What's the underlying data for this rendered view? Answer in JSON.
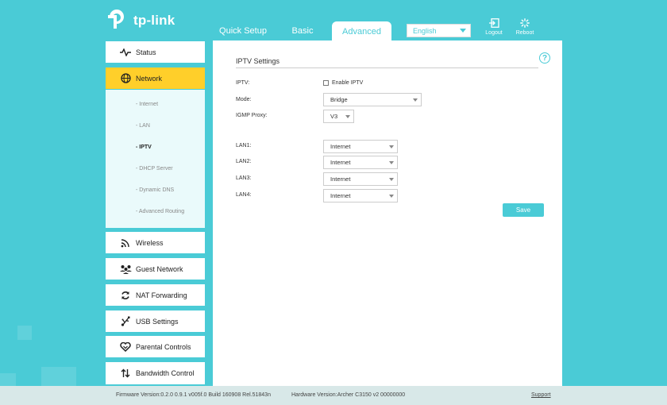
{
  "brand": {
    "name": "tp-link"
  },
  "tabs": [
    {
      "label": "Quick Setup"
    },
    {
      "label": "Basic"
    },
    {
      "label": "Advanced"
    }
  ],
  "language": {
    "selected": "English"
  },
  "header_buttons": {
    "logout": "Logout",
    "reboot": "Reboot"
  },
  "sidebar": {
    "items": [
      {
        "label": "Status",
        "icon": "pulse-icon"
      },
      {
        "label": "Network",
        "icon": "globe-icon"
      },
      {
        "label": "Wireless",
        "icon": "wifi-icon"
      },
      {
        "label": "Guest Network",
        "icon": "users-icon"
      },
      {
        "label": "NAT Forwarding",
        "icon": "refresh-icon"
      },
      {
        "label": "USB Settings",
        "icon": "usb-icon"
      },
      {
        "label": "Parental Controls",
        "icon": "heart-icon"
      },
      {
        "label": "Bandwidth Control",
        "icon": "updown-arrows-icon"
      }
    ],
    "network_sub": [
      "- Internet",
      "- LAN",
      "- IPTV",
      "- DHCP Server",
      "- Dynamic DNS",
      "- Advanced Routing"
    ]
  },
  "main": {
    "title": "IPTV Settings",
    "iptv_label": "IPTV:",
    "enable_iptv": "Enable IPTV",
    "mode_label": "Mode:",
    "mode_value": "Bridge",
    "igmp_label": "IGMP Proxy:",
    "igmp_value": "V3",
    "lans": [
      {
        "label": "LAN1:",
        "value": "Internet"
      },
      {
        "label": "LAN2:",
        "value": "Internet"
      },
      {
        "label": "LAN3:",
        "value": "Internet"
      },
      {
        "label": "LAN4:",
        "value": "Internet"
      }
    ],
    "save": "Save"
  },
  "footer": {
    "firmware": "Firmware Version:0.2.0 0.9.1 v005f.0 Build 160908 Rel.51843n",
    "hardware": "Hardware Version:Archer C3150 v2 00000000",
    "support": "Support"
  },
  "colors": {
    "accent": "#4acbd6",
    "active": "#ffcf2a"
  }
}
